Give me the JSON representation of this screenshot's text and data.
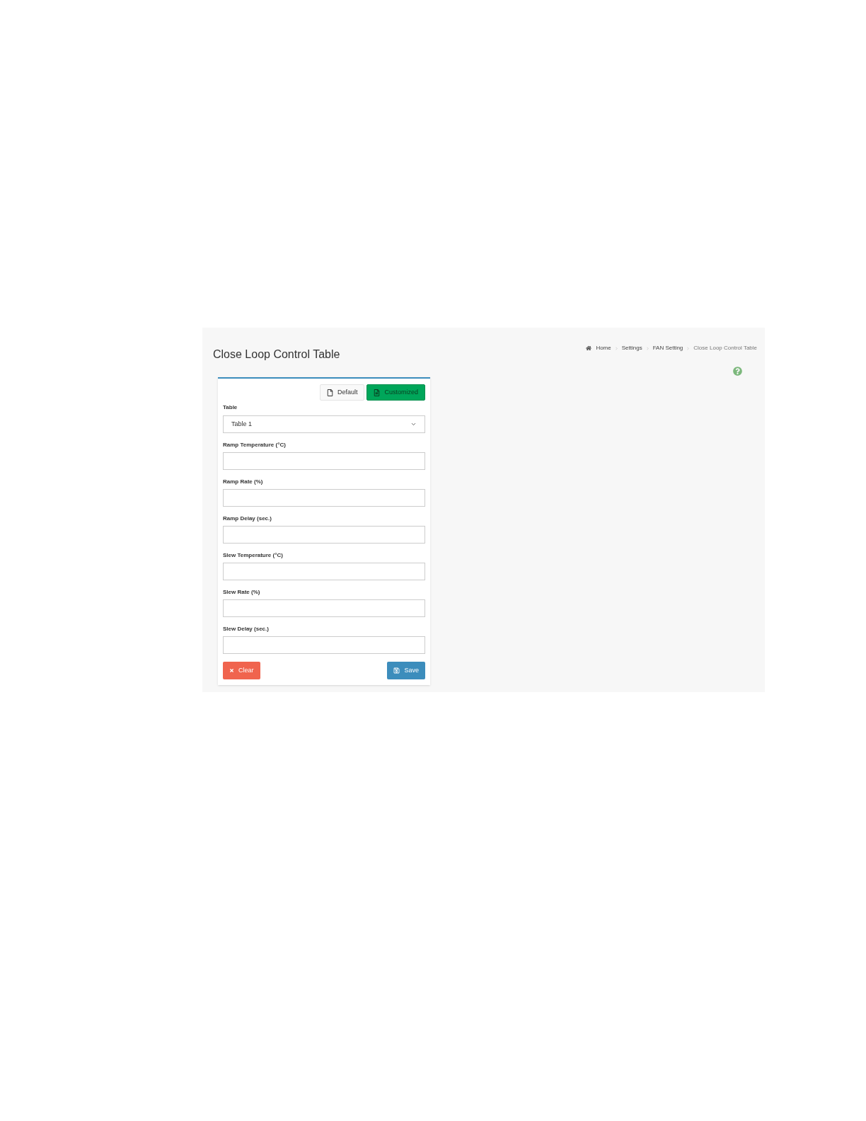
{
  "page": {
    "title": "Close Loop Control Table"
  },
  "breadcrumb": [
    {
      "label": "Home",
      "kind": "home"
    },
    {
      "label": "Settings",
      "kind": "link"
    },
    {
      "label": "FAN Setting",
      "kind": "link"
    },
    {
      "label": "Close Loop Control Table",
      "kind": "current"
    }
  ],
  "modes": [
    {
      "label": "Default",
      "selected": false
    },
    {
      "label": "Customized",
      "selected": true
    }
  ],
  "table_select": {
    "label": "Table",
    "value": "Table 1"
  },
  "fields": [
    {
      "label": "Ramp Temperature (°C)"
    },
    {
      "label": "Ramp Rate (%)"
    },
    {
      "label": "Ramp Delay (sec.)"
    },
    {
      "label": "Slew Temperature (°C)"
    },
    {
      "label": "Slew Rate (%)"
    },
    {
      "label": "Slew Delay (sec.)"
    }
  ],
  "buttons": {
    "clear": "Clear",
    "save": "Save"
  }
}
